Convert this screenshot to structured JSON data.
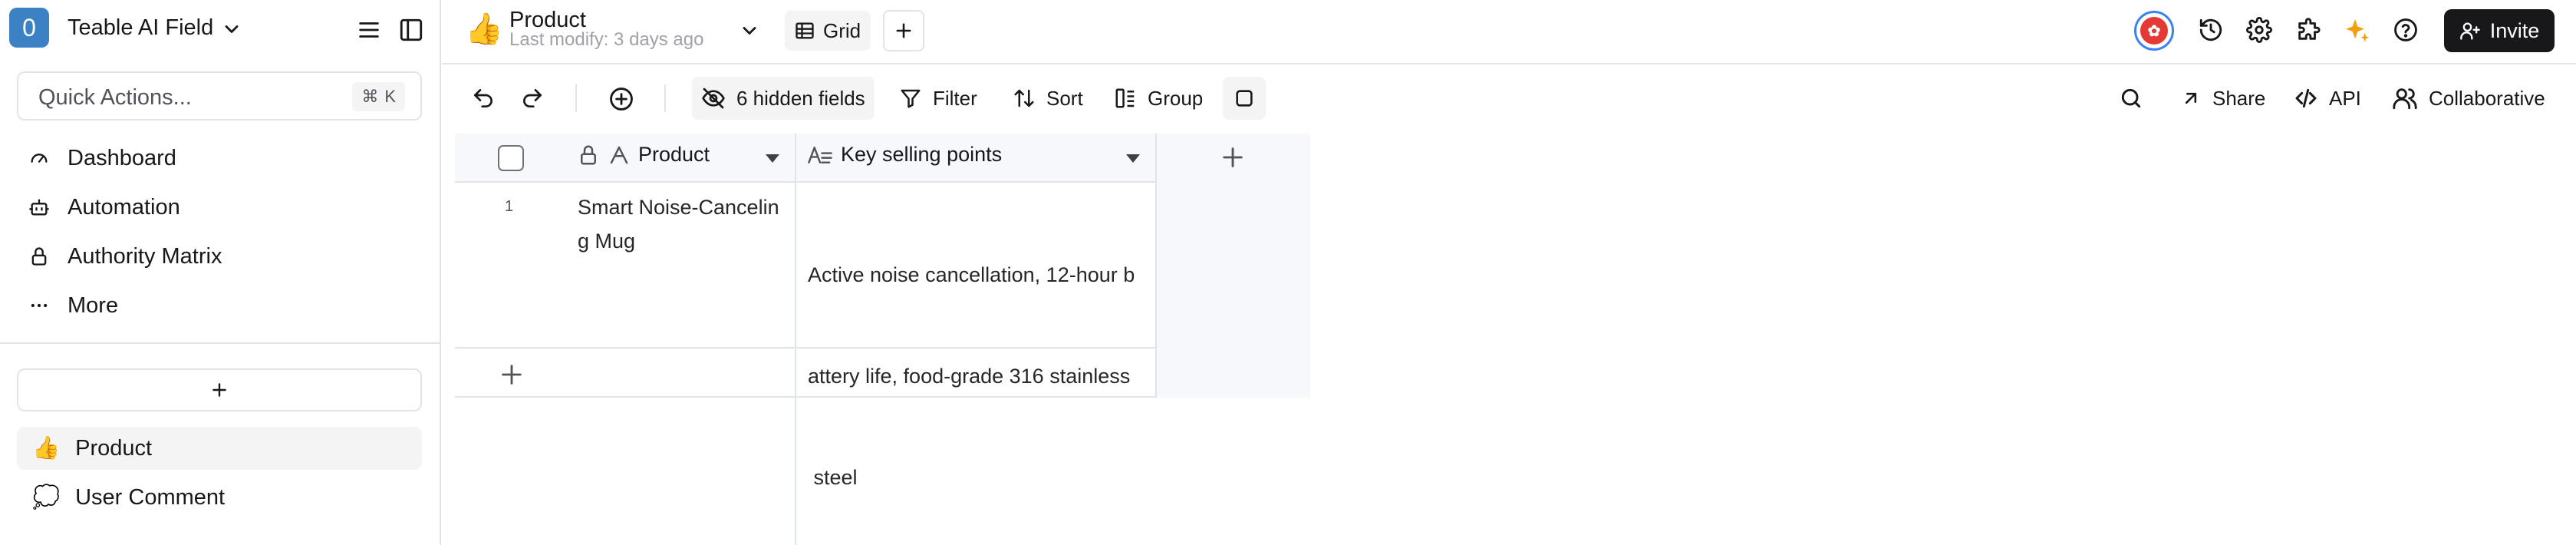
{
  "sidebar": {
    "space_badge": "0",
    "space_name": "Teable AI Field",
    "quick_actions": {
      "label": "Quick Actions...",
      "shortcut_symbol": "⌘",
      "shortcut_key": "K"
    },
    "nav": [
      {
        "label": "Dashboard",
        "icon": "gauge-icon"
      },
      {
        "label": "Automation",
        "icon": "bot-icon"
      },
      {
        "label": "Authority Matrix",
        "icon": "lock-icon"
      },
      {
        "label": "More",
        "icon": "ellipsis-icon"
      }
    ],
    "tables": [
      {
        "emoji": "👍",
        "label": "Product",
        "active": true
      },
      {
        "emoji": "💭",
        "label": "User Comment",
        "active": false
      }
    ]
  },
  "header": {
    "table_emoji": "👍",
    "table_name": "Product",
    "last_modify": "Last modify: 3 days ago",
    "view_tab": "Grid",
    "invite_label": "Invite"
  },
  "toolbar": {
    "hidden_fields": "6 hidden fields",
    "filter": "Filter",
    "sort": "Sort",
    "group": "Group",
    "share": "Share",
    "api": "API",
    "collaborative": "Collaborative"
  },
  "grid": {
    "columns": [
      {
        "name": "Product",
        "type_icon": "text-type-icon",
        "locked": true
      },
      {
        "name": "Key selling points",
        "type_icon": "long-text-type-icon",
        "locked": false
      }
    ],
    "rows": [
      {
        "number": "1",
        "product_lines": [
          "Smart Noise-Cancelin",
          "g Mug"
        ],
        "key_points_lines": [
          "Active noise cancellation, 12-hour b",
          "attery life, food-grade 316 stainless",
          " steel"
        ]
      }
    ]
  },
  "colors": {
    "accent_blue": "#3b82c4",
    "invite_bg": "#18181b",
    "sparkle": "#f59e0b",
    "grid_header_bg": "#f6f8fb"
  }
}
